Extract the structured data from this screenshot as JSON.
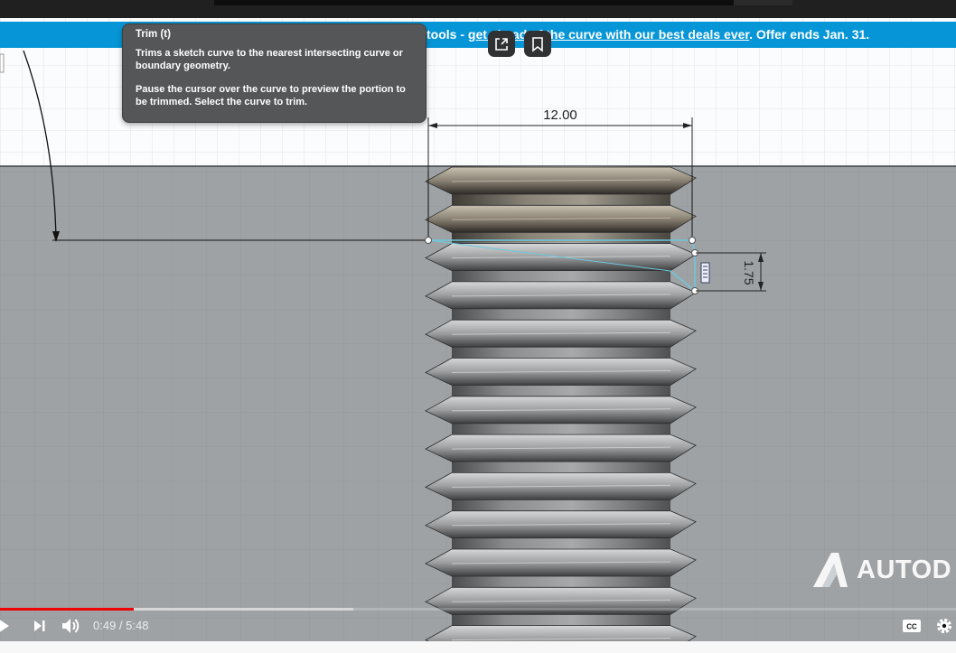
{
  "video": {
    "banner": {
      "prefix": "tools - ",
      "link": "get ahead of the curve with our best deals ever",
      "suffix": ". Offer ends Jan. 31."
    },
    "tooltip": {
      "title": "Trim (t)",
      "line1": "Trims a sketch curve to the nearest intersecting curve or boundary geometry.",
      "line2": "Pause the cursor over the curve to preview the portion to be trimmed. Select the curve to trim."
    },
    "dimensions": {
      "width_label": "12.00",
      "pitch_label": "1.75"
    },
    "watermark": "AUTOD"
  },
  "player": {
    "current_time": "0:49",
    "duration": "5:48",
    "time_display": "0:49 / 5:48",
    "progress_played_fraction": 0.14,
    "progress_buffered_fraction": 0.37,
    "icons": [
      "share-icon",
      "bookmark-icon",
      "play-icon",
      "next-icon",
      "volume-icon",
      "captions-icon",
      "settings-icon"
    ]
  },
  "colors": {
    "banner": "#0696d7",
    "tooltip_bg": "#555658",
    "progress": "#ff0000",
    "selection": "#6fc8dc"
  }
}
